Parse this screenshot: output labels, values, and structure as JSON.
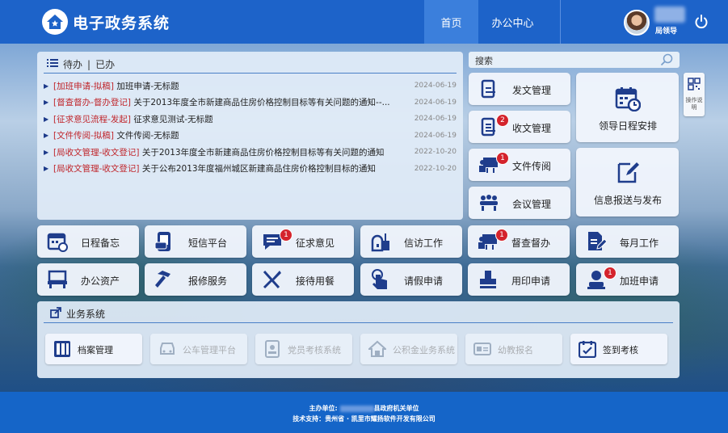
{
  "header": {
    "app_title": "电子政务系统",
    "nav": [
      {
        "label": "首页",
        "active": true
      },
      {
        "label": "办公中心",
        "active": false
      }
    ],
    "user_role": "局领导"
  },
  "todo": {
    "tab_pending": "待办",
    "tab_separator": "|",
    "tab_done": "已办",
    "items": [
      {
        "category": "[加班申请-拟稿]",
        "title": "加班申请-无标题",
        "date": "2024-06-19"
      },
      {
        "category": "[督查督办-督办登记]",
        "title": "关于2013年度全市新建商品住房价格控制目标等有关问题的通知--...",
        "date": "2024-06-19"
      },
      {
        "category": "[征求意见流程-发起]",
        "title": "征求意见测试-无标题",
        "date": "2024-06-19"
      },
      {
        "category": "[文件传阅-拟稿]",
        "title": "文件传阅-无标题",
        "date": "2024-06-19"
      },
      {
        "category": "[局收文管理-收文登记]",
        "title": "关于2013年度全市新建商品住房价格控制目标等有关问题的通知",
        "date": "2022-10-20"
      },
      {
        "category": "[局收文管理-收文登记]",
        "title": "关于公布2013年度福州城区新建商品住房价格控制目标的通知",
        "date": "2022-10-20"
      }
    ]
  },
  "search": {
    "label": "搜索"
  },
  "tiles_right": [
    {
      "label": "发文管理",
      "icon": "document-send-icon",
      "badge": ""
    },
    {
      "label": "收文管理",
      "icon": "document-receive-icon",
      "badge": "2"
    },
    {
      "label": "文件传阅",
      "icon": "presentation-icon",
      "badge": "1"
    },
    {
      "label": "会议管理",
      "icon": "meeting-icon",
      "badge": ""
    }
  ],
  "tiles_big": [
    {
      "label": "领导日程安排",
      "icon": "calendar-clock-icon"
    },
    {
      "label": "信息报送与发布",
      "icon": "edit-document-icon"
    }
  ],
  "side_tool": {
    "label": "操作说明"
  },
  "tiles_row1": [
    {
      "label": "日程备忘",
      "icon": "calendar-icon",
      "badge": ""
    },
    {
      "label": "短信平台",
      "icon": "sms-icon",
      "badge": ""
    },
    {
      "label": "征求意见",
      "icon": "chat-icon",
      "badge": "1"
    },
    {
      "label": "信访工作",
      "icon": "mailbox-icon",
      "badge": ""
    },
    {
      "label": "督查督办",
      "icon": "supervise-icon",
      "badge": "1"
    },
    {
      "label": "每月工作",
      "icon": "monthly-edit-icon",
      "badge": ""
    }
  ],
  "tiles_row2": [
    {
      "label": "办公资产",
      "icon": "desk-icon",
      "badge": ""
    },
    {
      "label": "报修服务",
      "icon": "hammer-icon",
      "badge": ""
    },
    {
      "label": "接待用餐",
      "icon": "utensils-icon",
      "badge": ""
    },
    {
      "label": "请假申请",
      "icon": "hand-pointer-icon",
      "badge": ""
    },
    {
      "label": "用印申请",
      "icon": "stamp-icon",
      "badge": ""
    },
    {
      "label": "加班申请",
      "icon": "user-overtime-icon",
      "badge": "1"
    }
  ],
  "business": {
    "title": "业务系统",
    "items": [
      {
        "label": "档案管理",
        "icon": "archive-icon",
        "enabled": true
      },
      {
        "label": "公车管理平台",
        "icon": "car-icon",
        "enabled": false
      },
      {
        "label": "党员考核系统",
        "icon": "member-icon",
        "enabled": false
      },
      {
        "label": "公积金业务系统",
        "icon": "house-icon",
        "enabled": false
      },
      {
        "label": "幼教报名",
        "icon": "id-card-icon",
        "enabled": false
      },
      {
        "label": "签到考核",
        "icon": "checkin-icon",
        "enabled": true
      }
    ]
  },
  "footer": {
    "host_prefix": "主办单位:",
    "host_suffix": "县政府机关单位",
    "support": "技术支持：贵州省 · 凯里市耀扬软件开发有限公司"
  },
  "colors": {
    "primary": "#1d63c9",
    "badge": "#d4232c",
    "category_text": "#c0262c",
    "icon": "#1f3d8c"
  }
}
